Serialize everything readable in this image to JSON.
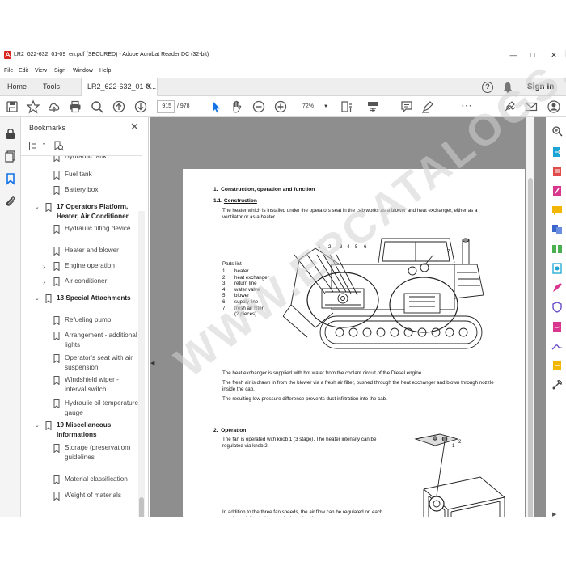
{
  "window": {
    "title": "LR2_622-632_01-09_en.pdf (SECURED) - Adobe Acrobat Reader DC (32-bit)"
  },
  "menu": [
    "File",
    "Edit",
    "View",
    "Sign",
    "Window",
    "Help"
  ],
  "tabs": {
    "home": "Home",
    "tools": "Tools",
    "doc": "LR2_622-632_01-0..."
  },
  "header": {
    "signin": "Sign In"
  },
  "toolbar": {
    "page_current": "915",
    "page_total": "/ 978",
    "zoom": "72%"
  },
  "bookmarks": {
    "title": "Bookmarks",
    "items": [
      {
        "label": "Hydraulic tank",
        "level": 2
      },
      {
        "label": "Fuel tank",
        "level": 2
      },
      {
        "label": "Battery box",
        "level": 2
      },
      {
        "label": "17 Operators Platform, Heater, Air Conditioner",
        "level": 1
      },
      {
        "label": "Hydraulic tilting device",
        "level": 2
      },
      {
        "label": "Heater and blower",
        "level": 2
      },
      {
        "label": "Engine operation",
        "level": 2
      },
      {
        "label": "Air conditioner",
        "level": 2
      },
      {
        "label": "18 Special Attachments",
        "level": 1
      },
      {
        "label": "Refueling pump",
        "level": 2
      },
      {
        "label": "Arrangement - additional lights",
        "level": 2
      },
      {
        "label": "Operator's seat with air suspension",
        "level": 2
      },
      {
        "label": "Windshield wiper - interval switch",
        "level": 2
      },
      {
        "label": "Hydraulic oil temperature gauge",
        "level": 2
      },
      {
        "label": "19 Miscellaneous Informations",
        "level": 1
      },
      {
        "label": "Storage (preservation) guidelines",
        "level": 2
      },
      {
        "label": "Material classification",
        "level": 2
      },
      {
        "label": "Weight of materials",
        "level": 2
      }
    ]
  },
  "page": {
    "sec1_num": "1.",
    "sec1_title": "Construction, operation and function",
    "sec11_num": "1.1.",
    "sec11_title": "Construction",
    "sec11_text": "The heater which is installed under the operators seat in the cab works as a blower and heat exchanger, either as a ventilator or as a heater.",
    "parts_title": "Parts list",
    "parts": [
      {
        "no": "1",
        "name": "heater"
      },
      {
        "no": "2",
        "name": "heat exchanger"
      },
      {
        "no": "3",
        "name": "return line"
      },
      {
        "no": "4",
        "name": "water valve"
      },
      {
        "no": "5",
        "name": "blower"
      },
      {
        "no": "6",
        "name": "supply line"
      },
      {
        "no": "7",
        "name": "fresh air filter"
      },
      {
        "no": "",
        "name": "(2 pieces)"
      }
    ],
    "callouts": [
      "1",
      "2",
      "3",
      "4",
      "5",
      "6",
      "7"
    ],
    "p1": "The heat exchanger is supplied with hot water from the coolant circuit of the Diesel engine.",
    "p2": "The fresh air is drawn in from the blower via a fresh air filter, pushed through the heat exchanger and blown through nozzle inside the cab.",
    "p3": "The resulting low pressure difference prevents dust infiltration into the cab.",
    "sec2_num": "2.",
    "sec2_title": "Operation",
    "sec2_text": "The fan is operated with knob 1 (3 stage). The heater intensity can be regulated via knob 2.",
    "sec2_text2": "In addition to the three fan speeds, the air flow can be regulated on each nozzle and directed in any desired direction.",
    "knob_labels": [
      "1",
      "2"
    ]
  },
  "watermark": "WWW.EPCATALOGS.COM"
}
